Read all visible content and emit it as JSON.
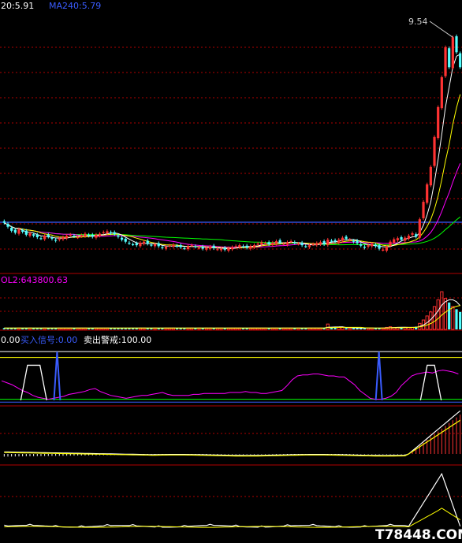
{
  "chart_data": [
    {
      "type": "candlestick",
      "panel": "price",
      "labels": {
        "ma_short": "20:5.91",
        "ma_long": "MA240:5.79",
        "peak": "9.54"
      },
      "colors": {
        "up": "#ff3232",
        "down": "#54ffff",
        "ma5": "#ffffff",
        "ma10": "#ffff00",
        "ma20": "#ff00ff",
        "ma60": "#00ff00",
        "ma240": "#3a5cff"
      },
      "close": [
        5.78,
        5.7,
        5.62,
        5.58,
        5.65,
        5.6,
        5.54,
        5.57,
        5.52,
        5.49,
        5.47,
        5.52,
        5.5,
        5.46,
        5.42,
        5.47,
        5.49,
        5.52,
        5.54,
        5.51,
        5.49,
        5.53,
        5.56,
        5.52,
        5.5,
        5.54,
        5.56,
        5.59,
        5.61,
        5.57,
        5.55,
        5.5,
        5.44,
        5.4,
        5.37,
        5.35,
        5.33,
        5.38,
        5.4,
        5.36,
        5.33,
        5.35,
        5.31,
        5.28,
        5.3,
        5.32,
        5.34,
        5.31,
        5.29,
        5.27,
        5.31,
        5.33,
        5.3,
        5.28,
        5.26,
        5.28,
        5.3,
        5.27,
        5.25,
        5.26,
        5.24,
        5.27,
        5.29,
        5.31,
        5.33,
        5.3,
        5.28,
        5.31,
        5.33,
        5.36,
        5.39,
        5.37,
        5.35,
        5.38,
        5.41,
        5.38,
        5.36,
        5.39,
        5.41,
        5.38,
        5.36,
        5.33,
        5.31,
        5.33,
        5.35,
        5.37,
        5.39,
        5.35,
        5.44,
        5.41,
        5.4,
        5.44,
        5.48,
        5.46,
        5.44,
        5.4,
        5.37,
        5.32,
        5.28,
        5.33,
        5.36,
        5.31,
        5.26,
        5.24,
        5.3,
        5.4,
        5.45,
        5.47,
        5.44,
        5.48,
        5.52,
        5.57,
        5.5,
        5.85,
        6.2,
        6.55,
        6.9,
        7.5,
        8.1,
        8.7,
        9.3,
        8.9,
        9.5,
        9.2,
        8.9
      ],
      "ma_periods": [
        5,
        10,
        20,
        60,
        240
      ],
      "ma240": 5.79,
      "ylim": [
        5.0,
        9.9
      ]
    },
    {
      "type": "bar",
      "panel": "volume",
      "label": "OL2:643800.63",
      "colors": {
        "label": "#ff00ff",
        "up": "#ff3232",
        "down": "#54ffff",
        "ma": "#ffffff",
        "ma2": "#ffff00"
      },
      "values": [
        2,
        2,
        2,
        2,
        2,
        2,
        2,
        2,
        2,
        2,
        2,
        2,
        2,
        2,
        2,
        2,
        2,
        2,
        2,
        2,
        2,
        2,
        2,
        2,
        2,
        2,
        2,
        2,
        2,
        2,
        2,
        2,
        2,
        2,
        2,
        2,
        2,
        2,
        2,
        2,
        2,
        2,
        2,
        2,
        2,
        2,
        2,
        2,
        2,
        2,
        2,
        2,
        2,
        2,
        2,
        2,
        2,
        2,
        2,
        2,
        2,
        2,
        2,
        2,
        2,
        2,
        2,
        2,
        2,
        2,
        2,
        2,
        2,
        2,
        2,
        2,
        2,
        2,
        2,
        2,
        2,
        2,
        2,
        2,
        2,
        2,
        2,
        2,
        8,
        3,
        3,
        3,
        3,
        2,
        2,
        2,
        2,
        2,
        2,
        2,
        2,
        2,
        2,
        2,
        3,
        4,
        3,
        3,
        3,
        3,
        3,
        3,
        4,
        9,
        14,
        20,
        26,
        34,
        44,
        56,
        46,
        40,
        34,
        30,
        26
      ],
      "ylim": [
        0,
        62
      ]
    },
    {
      "type": "line",
      "panel": "signal",
      "labels": [
        {
          "text": "0.00",
          "color": "#ffffff"
        },
        {
          "text": "买入信号:0.00",
          "color": "#3a5cff"
        },
        {
          "text": "卖出警戒:100.00",
          "color": "#ffffff"
        }
      ],
      "colors": {
        "k": "#ff00ff",
        "buy": "#3a5cff",
        "sell": "#ffffff",
        "h_white": "#ffffff",
        "h_yellow": "#ffff00",
        "h_green": "#00ff00",
        "h_blue": "#3a5cff"
      },
      "k": [
        40,
        36,
        32,
        26,
        20,
        16,
        10,
        6,
        4,
        2,
        4,
        6,
        8,
        12,
        14,
        16,
        18,
        22,
        24,
        18,
        14,
        10,
        8,
        6,
        4,
        6,
        8,
        10,
        10,
        12,
        14,
        16,
        12,
        10,
        10,
        10,
        10,
        12,
        12,
        14,
        14,
        14,
        14,
        14,
        16,
        16,
        16,
        18,
        16,
        16,
        14,
        14,
        16,
        18,
        20,
        30,
        42,
        50,
        52,
        52,
        54,
        54,
        52,
        50,
        50,
        48,
        48,
        40,
        32,
        20,
        12,
        4,
        2,
        2,
        4,
        8,
        16,
        30,
        40,
        50,
        54,
        56,
        58,
        56,
        60,
        62,
        60,
        58,
        54
      ],
      "sell_spikes": [
        [
          17,
          7
        ],
        [
          17,
          88
        ],
        [
          60,
          10
        ],
        [
          60,
          90
        ]
      ],
      "ylim": [
        -10,
        110
      ]
    },
    {
      "type": "bar",
      "panel": "macd",
      "colors": {
        "up": "#ff3232",
        "down": "#ffffff",
        "dif": "#ffffff",
        "dea": "#ffff00"
      },
      "ylim": [
        -20,
        60
      ]
    },
    {
      "type": "line",
      "panel": "oscillator",
      "colors": {
        "a": "#ffffff",
        "b": "#ffff00"
      },
      "ylim": [
        0,
        100
      ]
    }
  ],
  "watermark": "T78448.COM"
}
